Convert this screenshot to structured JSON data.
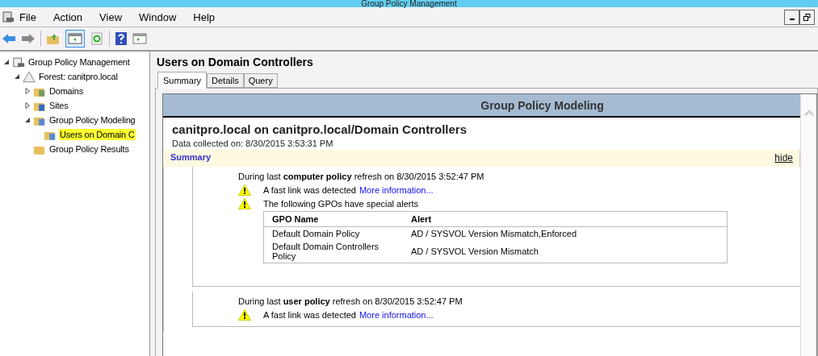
{
  "window": {
    "title": "Group Policy Management"
  },
  "menu": [
    "File",
    "Action",
    "View",
    "Window",
    "Help"
  ],
  "tree": [
    {
      "label": "Group Policy Management",
      "expanded": true,
      "selected": false,
      "children": [
        {
          "label": "Forest: canitpro.local",
          "expanded": true,
          "selected": false,
          "children": [
            {
              "label": "Domains",
              "expanded": false,
              "selected": false
            },
            {
              "label": "Sites",
              "expanded": false,
              "selected": false
            },
            {
              "label": "Group Policy Modeling",
              "expanded": true,
              "selected": false,
              "children": [
                {
                  "label": "Users on Domain C",
                  "selected": true
                }
              ]
            },
            {
              "label": "Group Policy Results",
              "selected": false
            }
          ]
        }
      ]
    }
  ],
  "pane_title": "Users on Domain Controllers",
  "tabs": [
    {
      "label": "Summary",
      "selected": true
    },
    {
      "label": "Details",
      "selected": false
    },
    {
      "label": "Query",
      "selected": false
    }
  ],
  "report": {
    "banner": "Group Policy Modeling",
    "heading": "canitpro.local on canitpro.local/Domain Controllers",
    "collected": "Data collected on: 8/30/2015 3:53:31 PM",
    "section": "Summary",
    "hide": "hide",
    "blocks": [
      {
        "refresh": "During last **computer policy** refresh on 8/30/2015 3:52:47 PM",
        "warnings": [
          {
            "text": "A fast link was detected",
            "link": "More information..."
          },
          {
            "text": "The following GPOs have special alerts"
          }
        ],
        "table": {
          "columns": [
            "GPO Name",
            "Alert"
          ],
          "rows": [
            [
              "Default Domain Policy",
              "AD / SYSVOL Version Mismatch,Enforced"
            ],
            [
              "Default Domain Controllers Policy",
              "AD / SYSVOL Version Mismatch"
            ]
          ]
        }
      },
      {
        "refresh": "During last **user policy** refresh on 8/30/2015 3:52:47 PM",
        "warnings": [
          {
            "text": "A fast link was detected",
            "link": "More information..."
          }
        ]
      }
    ]
  }
}
